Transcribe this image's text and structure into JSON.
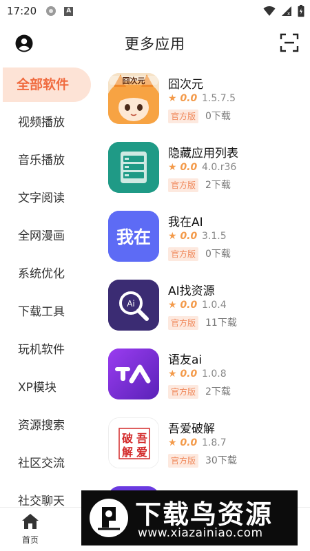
{
  "status_bar": {
    "time": "17:20"
  },
  "header": {
    "title": "更多应用"
  },
  "sidebar": {
    "items": [
      {
        "label": "全部软件",
        "active": true
      },
      {
        "label": "视频播放"
      },
      {
        "label": "音乐播放"
      },
      {
        "label": "文字阅读"
      },
      {
        "label": "全网漫画"
      },
      {
        "label": "系统优化"
      },
      {
        "label": "下载工具"
      },
      {
        "label": "玩机软件"
      },
      {
        "label": "XP模块"
      },
      {
        "label": "资源搜索"
      },
      {
        "label": "社区交流"
      },
      {
        "label": "社交聊天"
      }
    ]
  },
  "apps": [
    {
      "name": "囧次元",
      "rating": "0.0",
      "version": "1.5.7.5",
      "badge": "官方版",
      "downloads": "0下载",
      "icon": "anime-girl-icon",
      "icon_text": "囧次元"
    },
    {
      "name": "隐藏应用列表",
      "rating": "0.0",
      "version": "4.0.r36",
      "badge": "官方版",
      "downloads": "2下载",
      "icon": "list-icon"
    },
    {
      "name": "我在AI",
      "rating": "0.0",
      "version": "3.1.5",
      "badge": "官方版",
      "downloads": "0下载",
      "icon": "woai-icon",
      "icon_text": "我在"
    },
    {
      "name": "AI找资源",
      "rating": "0.0",
      "version": "1.0.4",
      "badge": "官方版",
      "downloads": "11下载",
      "icon": "ai-search-icon",
      "icon_text": "Ai"
    },
    {
      "name": "语友ai",
      "rating": "0.0",
      "version": "1.0.8",
      "badge": "官方版",
      "downloads": "2下载",
      "icon": "yuyou-icon"
    },
    {
      "name": "吾爱破解",
      "rating": "0.0",
      "version": "1.8.7",
      "badge": "官方版",
      "downloads": "30下载",
      "icon": "52pojie-icon",
      "icon_text": [
        "破",
        "吾",
        "解",
        "爱"
      ]
    }
  ],
  "rating_star": "★",
  "bottom_nav": {
    "home_label": "首页"
  },
  "watermark": {
    "title": "下载鸟资源",
    "url": "www.xiazainiao.com"
  },
  "colors": {
    "accent": "#f06b3f",
    "active_bg": "#fde3d6",
    "star": "#f39a4a"
  }
}
